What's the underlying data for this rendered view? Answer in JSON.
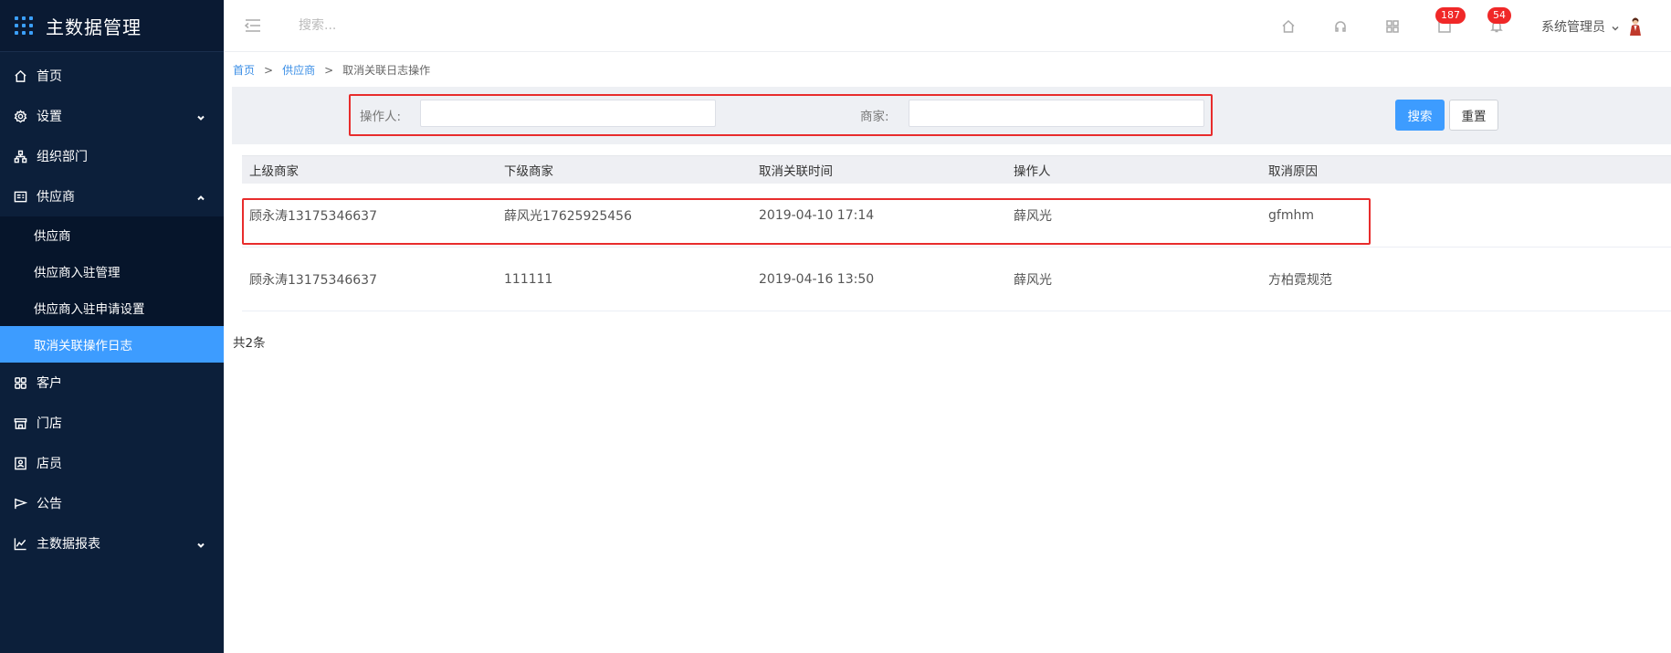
{
  "app": {
    "title": "主数据管理",
    "accent_color": "#3d9cff",
    "sidebar_bg": "#0c1f3a",
    "highlight_color": "#e82c2c"
  },
  "sidebar": {
    "items": [
      {
        "label": "首页",
        "icon": "home-icon"
      },
      {
        "label": "设置",
        "icon": "gear-icon",
        "expandable": true
      },
      {
        "label": "组织部门",
        "icon": "org-tree-icon"
      },
      {
        "label": "供应商",
        "icon": "supplier-icon",
        "expanded": true
      },
      {
        "label": "客户",
        "icon": "customer-icon"
      },
      {
        "label": "门店",
        "icon": "store-icon"
      },
      {
        "label": "店员",
        "icon": "staff-icon"
      },
      {
        "label": "公告",
        "icon": "announcement-icon"
      },
      {
        "label": "主数据报表",
        "icon": "chart-line-icon",
        "expandable": true
      }
    ],
    "supplier_sub": [
      {
        "label": "供应商"
      },
      {
        "label": "供应商入驻管理"
      },
      {
        "label": "供应商入驻申请设置"
      },
      {
        "label": "取消关联操作日志",
        "active": true
      }
    ]
  },
  "header": {
    "search_placeholder": "搜索...",
    "badges": {
      "messages": "187",
      "notifications": "54"
    },
    "user_name": "系统管理员"
  },
  "breadcrumb": {
    "home": "首页",
    "sep": ">",
    "supplier": "供应商",
    "current": "取消关联日志操作"
  },
  "filter": {
    "operator_label": "操作人:",
    "operator_value": "",
    "merchant_label": "商家:",
    "merchant_value": "",
    "search_button": "搜索",
    "reset_button": "重置"
  },
  "table": {
    "columns": [
      "上级商家",
      "下级商家",
      "取消关联时间",
      "操作人",
      "取消原因"
    ],
    "rows": [
      [
        "顾永涛13175346637",
        "薛风光17625925456",
        "2019-04-10 17:14",
        "薛风光",
        "gfmhm"
      ],
      [
        "顾永涛13175346637",
        "111111",
        "2019-04-16 13:50",
        "薛风光",
        "方柏霓规范"
      ]
    ]
  },
  "total": "共2条"
}
